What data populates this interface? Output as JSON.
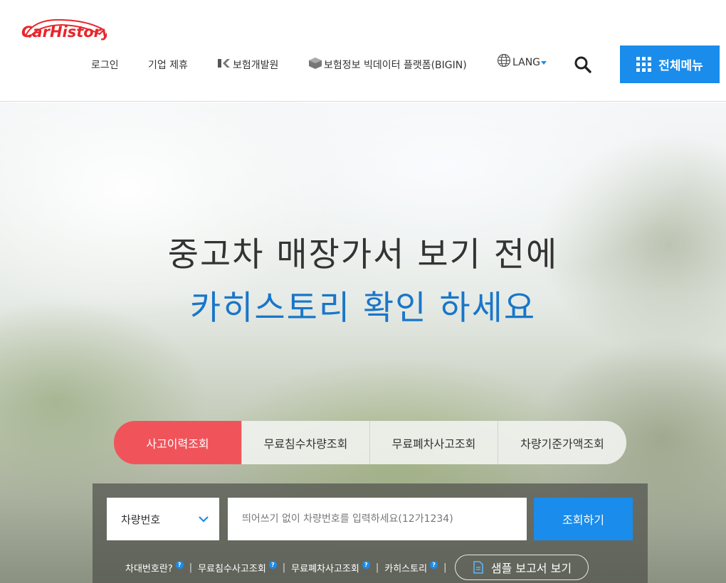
{
  "header": {
    "logo_text": "CarHistory",
    "nav": {
      "login": "로그인",
      "partner": "기업 제휴",
      "kidi": "보험개발원",
      "bigin": "보험정보 빅데이터 플랫폼(BIGIN)",
      "lang": "LANG"
    },
    "menu_label": "전체메뉴"
  },
  "hero": {
    "line1": "중고차 매장가서 보기 전에",
    "line2": "카히스토리 확인 하세요"
  },
  "tabs": [
    {
      "label": "사고이력조회",
      "active": true
    },
    {
      "label": "무료침수차량조회",
      "active": false
    },
    {
      "label": "무료폐차사고조회",
      "active": false
    },
    {
      "label": "차량기준가액조회",
      "active": false
    }
  ],
  "search": {
    "select_value": "차량번호",
    "placeholder": "띄어쓰기 없이 차량번호를 입력하세요(12가1234)",
    "submit_label": "조회하기"
  },
  "help_links": {
    "chassis": "차대번호란?",
    "flood": "무료침수사고조회",
    "scrap": "무료폐차사고조회",
    "carhistory": "카히스토리",
    "sample": "샘플 보고서 보기"
  },
  "colors": {
    "accent_blue": "#1a8ceb",
    "active_tab_red": "#f0545a",
    "hero_blue_text": "#1976c9"
  }
}
